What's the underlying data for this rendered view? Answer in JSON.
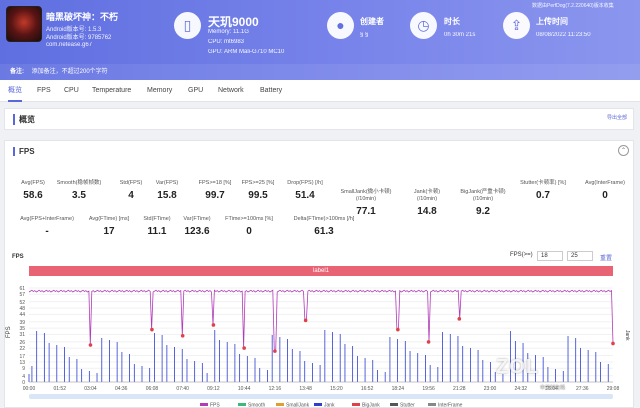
{
  "game": {
    "title": "暗黑破坏神：不朽",
    "android_version": "Android版本号: 1.5.3",
    "android_code": "Android版本号: 9785762",
    "package": "com.netease.g67"
  },
  "device": {
    "title": "天玑9000",
    "memory": "Memory: 11.1G",
    "cpu": "CPU: mt6983",
    "gpu": "GPU: ARM Mali-G710 MC10"
  },
  "creator": {
    "title": "创建者",
    "value": "§ §"
  },
  "duration": {
    "title": "时长",
    "value": "0h 30m 21s"
  },
  "upload": {
    "title": "上传时间",
    "value": "08/08/2022 11:23:50"
  },
  "tool_note": "数据由PerfDog(7.2.220640)版本收集",
  "remark": {
    "label": "备注:",
    "placeholder": "添加备注，不超过200个字符"
  },
  "tabs": [
    "概览",
    "FPS",
    "CPU",
    "Temperature",
    "Memory",
    "GPU",
    "Network",
    "Battery"
  ],
  "overview": {
    "title": "概览",
    "export": "导出全部"
  },
  "fps_section": {
    "title": "FPS",
    "collapse": "⌃"
  },
  "metrics_row1": [
    {
      "label": "Avg(FPS)",
      "value": "58.6"
    },
    {
      "label": "Smooth(稳帧帧数)",
      "value": "3.5"
    },
    {
      "label": "Std(FPS)",
      "value": "4"
    },
    {
      "label": "Var(FPS)",
      "value": "15.8"
    },
    {
      "label": "FPS>=18 [%]",
      "value": "99.7"
    },
    {
      "label": "FPS>=25 [%]",
      "value": "99.5"
    },
    {
      "label": "Drop(FPS) [/h]",
      "value": "51.4"
    },
    {
      "label": "SmallJank(微小卡顿)\n(/10min)",
      "value": "77.1"
    },
    {
      "label": "Jank(卡顿)\n(/10min)",
      "value": "14.8"
    },
    {
      "label": "BigJank(严重卡顿)\n(/10min)",
      "value": "9.2"
    },
    {
      "label": "Stutter(卡顿率) [%]",
      "value": "0.7"
    },
    {
      "label": "Avg(InterFrame)",
      "value": "0"
    }
  ],
  "metrics_row2": [
    {
      "label": "Avg(FPS+InterFrame)",
      "value": "-"
    },
    {
      "label": "Avg(FTime) [ms]",
      "value": "17"
    },
    {
      "label": "Std(FTime)",
      "value": "11.1"
    },
    {
      "label": "Var(FTime)",
      "value": "123.6"
    },
    {
      "label": "FTime>=100ms [%]",
      "value": "0"
    },
    {
      "label": "Delta(FTime)>100ms [/h]",
      "value": "61.3"
    }
  ],
  "chart_controls": {
    "label": "FPS",
    "range_label": "FPS(>=)",
    "low": "18",
    "high": "25",
    "apply": "重置"
  },
  "label_bar": "label1",
  "colors": {
    "accent": "#5a67d8",
    "fps_line": "#b03cb8",
    "jank": "#2c3fd0",
    "label": "#e86474"
  },
  "chart_data": {
    "type": "line",
    "y_ticks": [
      61,
      57,
      52,
      48,
      44,
      39,
      35,
      31,
      26,
      22,
      17,
      13,
      9,
      4,
      0
    ],
    "ylim": [
      0,
      61
    ],
    "y_label": "FPS",
    "right_label": "Jank",
    "x_ticks": [
      "00:00",
      "01:52",
      "03:04",
      "04:36",
      "06:08",
      "07:40",
      "09:12",
      "10:44",
      "12:16",
      "13:48",
      "15:20",
      "16:52",
      "18:24",
      "19:56",
      "21:28",
      "23:00",
      "24:32",
      "26:04",
      "27:36",
      "29:08"
    ],
    "legend": [
      "FPS",
      "Smooth",
      "SmallJank",
      "Jank",
      "BigJank",
      "Stutter",
      "InterFrame"
    ],
    "fps_baseline": 59,
    "dips": [
      {
        "t": "03:04",
        "fps": 24
      },
      {
        "t": "06:08",
        "fps": 34
      },
      {
        "t": "07:40",
        "fps": 30
      },
      {
        "t": "09:12",
        "fps": 37
      },
      {
        "t": "10:44",
        "fps": 22
      },
      {
        "t": "12:16",
        "fps": 20
      },
      {
        "t": "13:48",
        "fps": 40
      },
      {
        "t": "18:24",
        "fps": 34
      },
      {
        "t": "19:56",
        "fps": 26
      },
      {
        "t": "21:28",
        "fps": 41
      },
      {
        "t": "29:08",
        "fps": 25
      }
    ]
  },
  "watermark": {
    "logo": "ZOL",
    "sub": "中关村在线"
  }
}
